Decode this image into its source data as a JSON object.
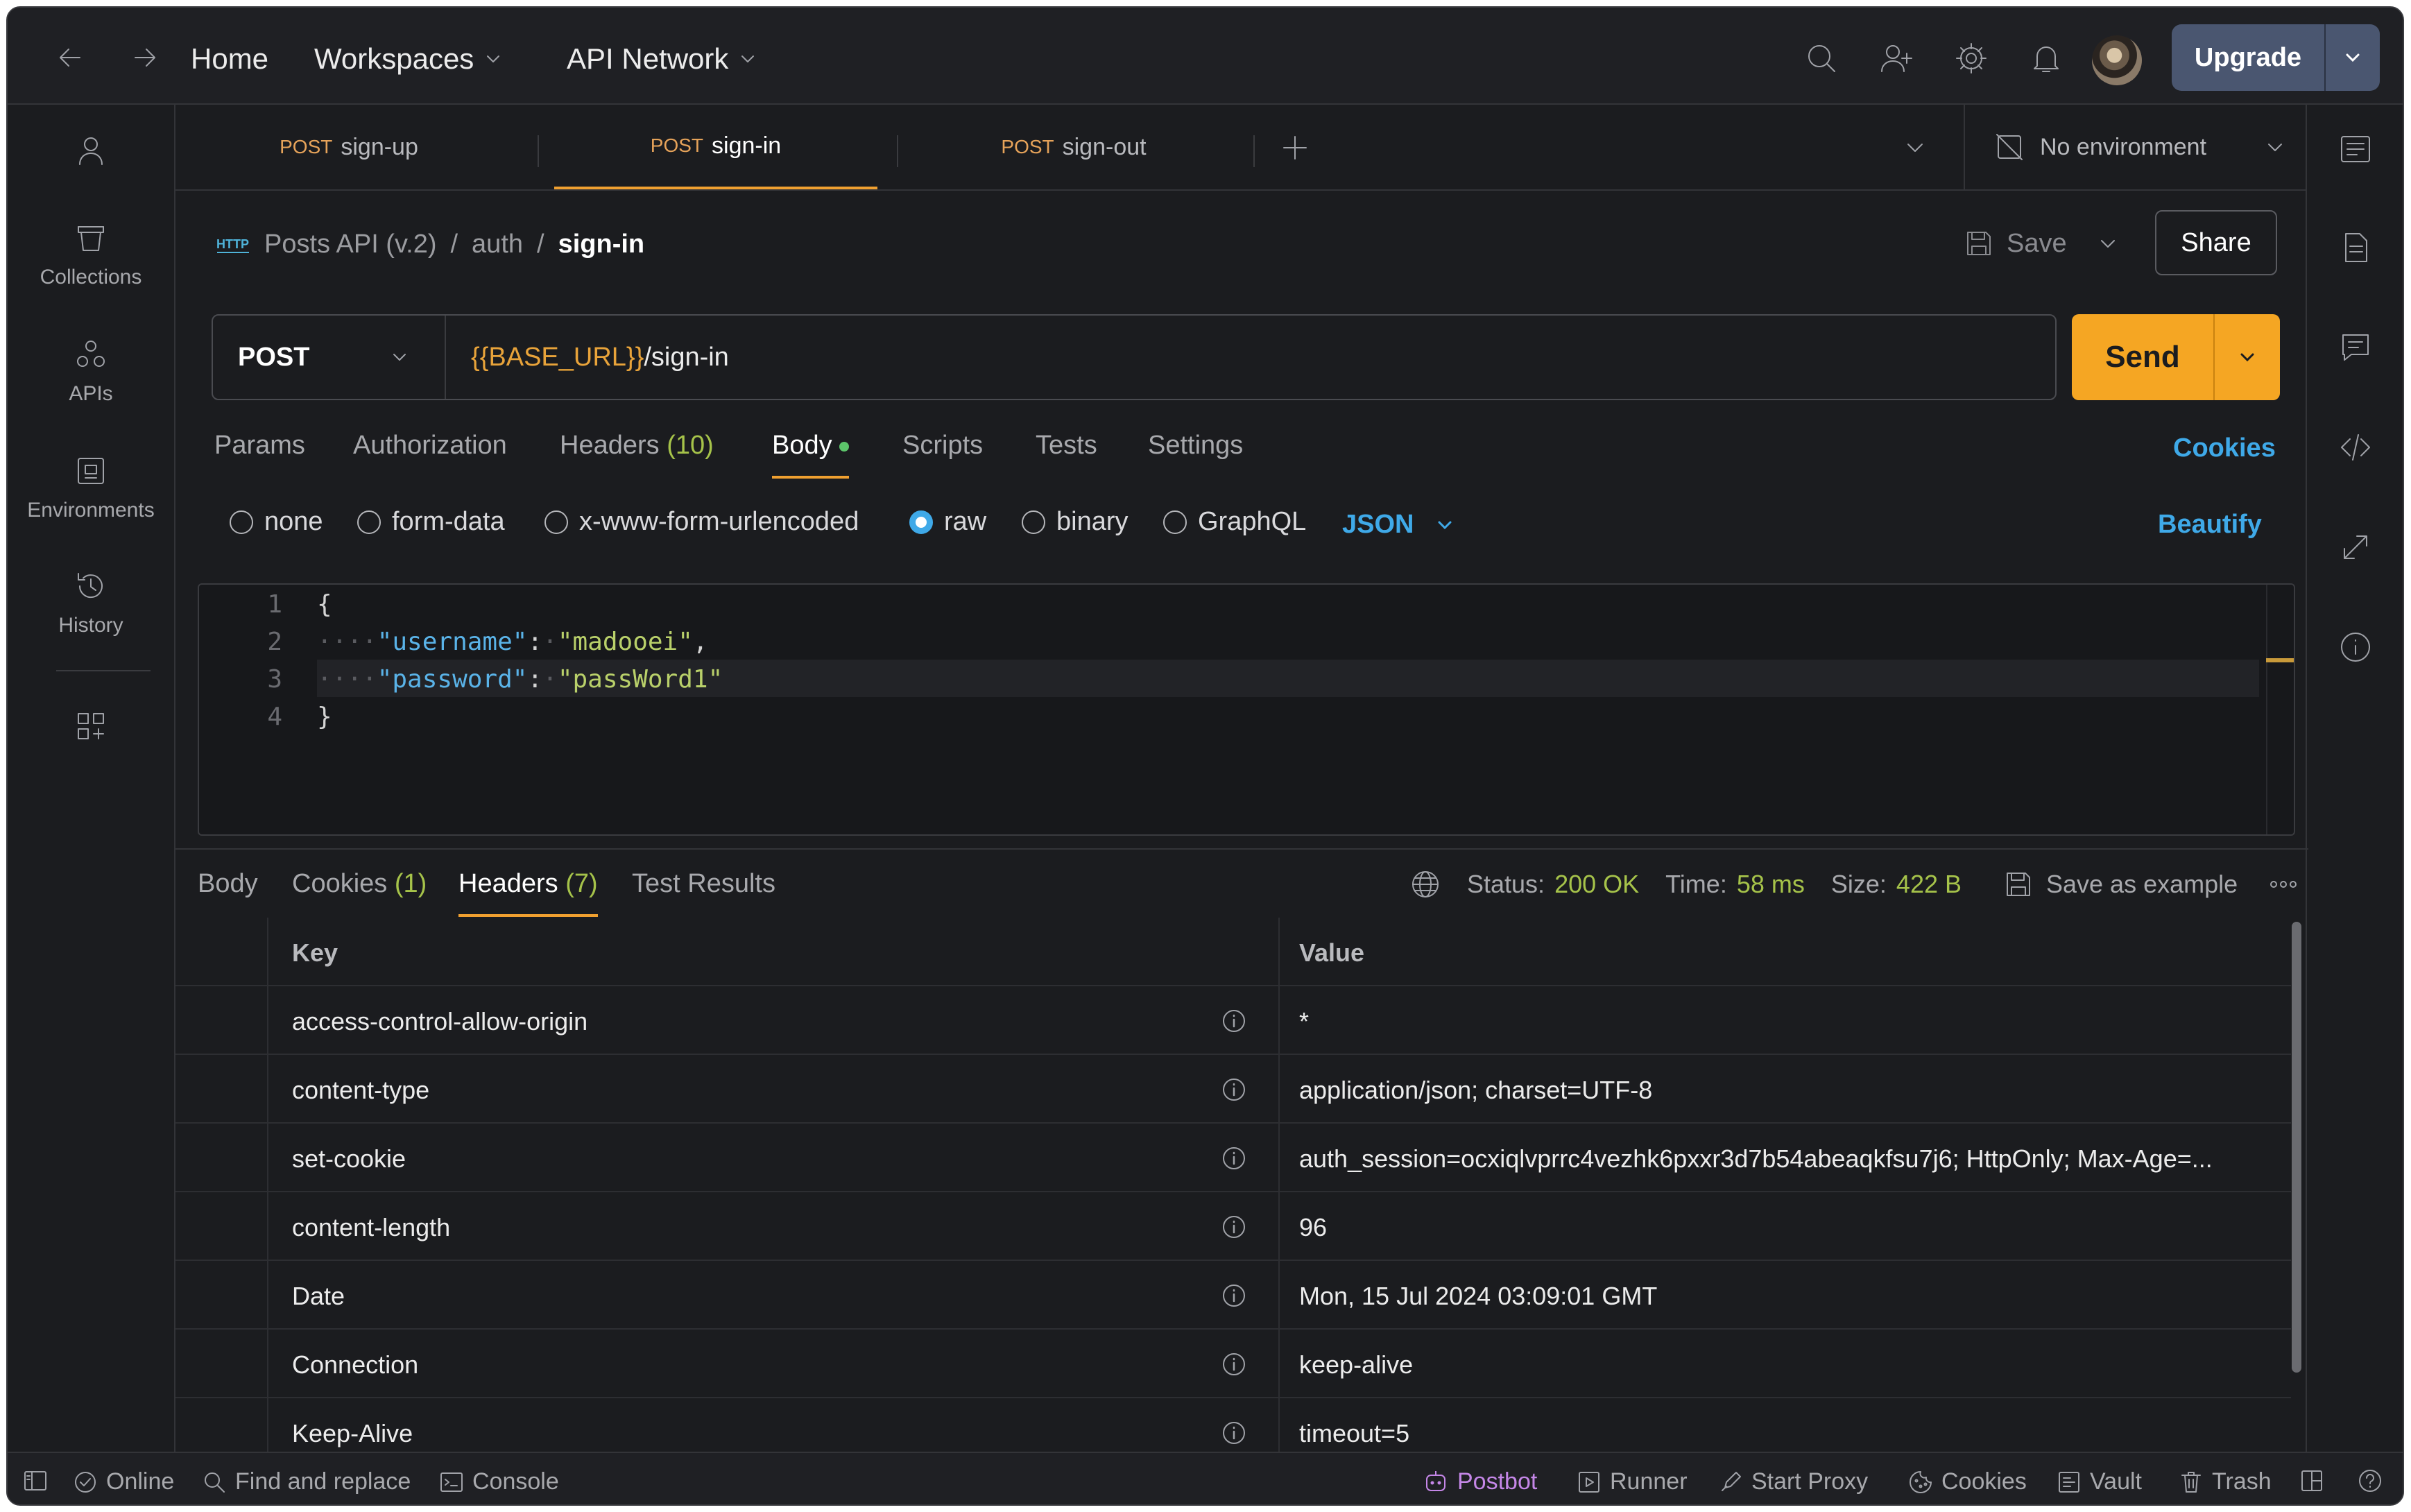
{
  "topbar": {
    "home": "Home",
    "workspaces": "Workspaces",
    "api_network": "API Network",
    "upgrade": "Upgrade"
  },
  "sidebar": {
    "items": [
      {
        "label": "Collections"
      },
      {
        "label": "APIs"
      },
      {
        "label": "Environments"
      },
      {
        "label": "History"
      }
    ]
  },
  "tabs": [
    {
      "method": "POST",
      "name": "sign-up"
    },
    {
      "method": "POST",
      "name": "sign-in"
    },
    {
      "method": "POST",
      "name": "sign-out"
    }
  ],
  "environment": "No environment",
  "breadcrumb": {
    "icon_text": "HTTP",
    "collection": "Posts API (v.2)",
    "folder": "auth",
    "current": "sign-in",
    "sep": "/"
  },
  "actions": {
    "save": "Save",
    "share": "Share"
  },
  "request": {
    "method": "POST",
    "url_var": "{{BASE_URL}}",
    "url_path": "/sign-in",
    "send": "Send"
  },
  "request_tabs": {
    "params": "Params",
    "authorization": "Authorization",
    "headers": "Headers",
    "headers_count": "(10)",
    "body": "Body",
    "scripts": "Scripts",
    "tests": "Tests",
    "settings": "Settings",
    "cookies": "Cookies"
  },
  "body_types": {
    "none": "none",
    "form_data": "form-data",
    "urlencoded": "x-www-form-urlencoded",
    "raw": "raw",
    "binary": "binary",
    "graphql": "GraphQL",
    "format": "JSON",
    "beautify": "Beautify"
  },
  "editor": {
    "line_numbers": [
      "1",
      "2",
      "3",
      "4"
    ],
    "open_brace": "{",
    "close_brace": "}",
    "username_key": "\"username\"",
    "username_val": "\"madooei\"",
    "password_key": "\"password\"",
    "password_val": "\"passWord1\""
  },
  "response_tabs": {
    "body": "Body",
    "cookies": "Cookies",
    "cookies_count": "(1)",
    "headers": "Headers",
    "headers_count": "(7)",
    "test_results": "Test Results"
  },
  "response_meta": {
    "status_label": "Status:",
    "status": "200 OK",
    "time_label": "Time:",
    "time": "58 ms",
    "size_label": "Size:",
    "size": "422 B",
    "save_example": "Save as example"
  },
  "headers_table": {
    "col_key": "Key",
    "col_value": "Value",
    "rows": [
      {
        "key": "access-control-allow-origin",
        "value": "*"
      },
      {
        "key": "content-type",
        "value": "application/json; charset=UTF-8"
      },
      {
        "key": "set-cookie",
        "value": "auth_session=ocxiqlvprrc4vezhk6pxxr3d7b54abeaqkfsu7j6; HttpOnly; Max-Age=..."
      },
      {
        "key": "content-length",
        "value": "96"
      },
      {
        "key": "Date",
        "value": "Mon, 15 Jul 2024 03:09:01 GMT"
      },
      {
        "key": "Connection",
        "value": "keep-alive"
      },
      {
        "key": "Keep-Alive",
        "value": "timeout=5"
      }
    ]
  },
  "statusbar": {
    "online": "Online",
    "find_replace": "Find and replace",
    "console": "Console",
    "postbot": "Postbot",
    "runner": "Runner",
    "start_proxy": "Start Proxy",
    "cookies": "Cookies",
    "vault": "Vault",
    "trash": "Trash"
  },
  "colors": {
    "accent": "#f5a623",
    "link": "#3fa9e8",
    "success": "#a6c34a",
    "method": "#e6a35a"
  }
}
